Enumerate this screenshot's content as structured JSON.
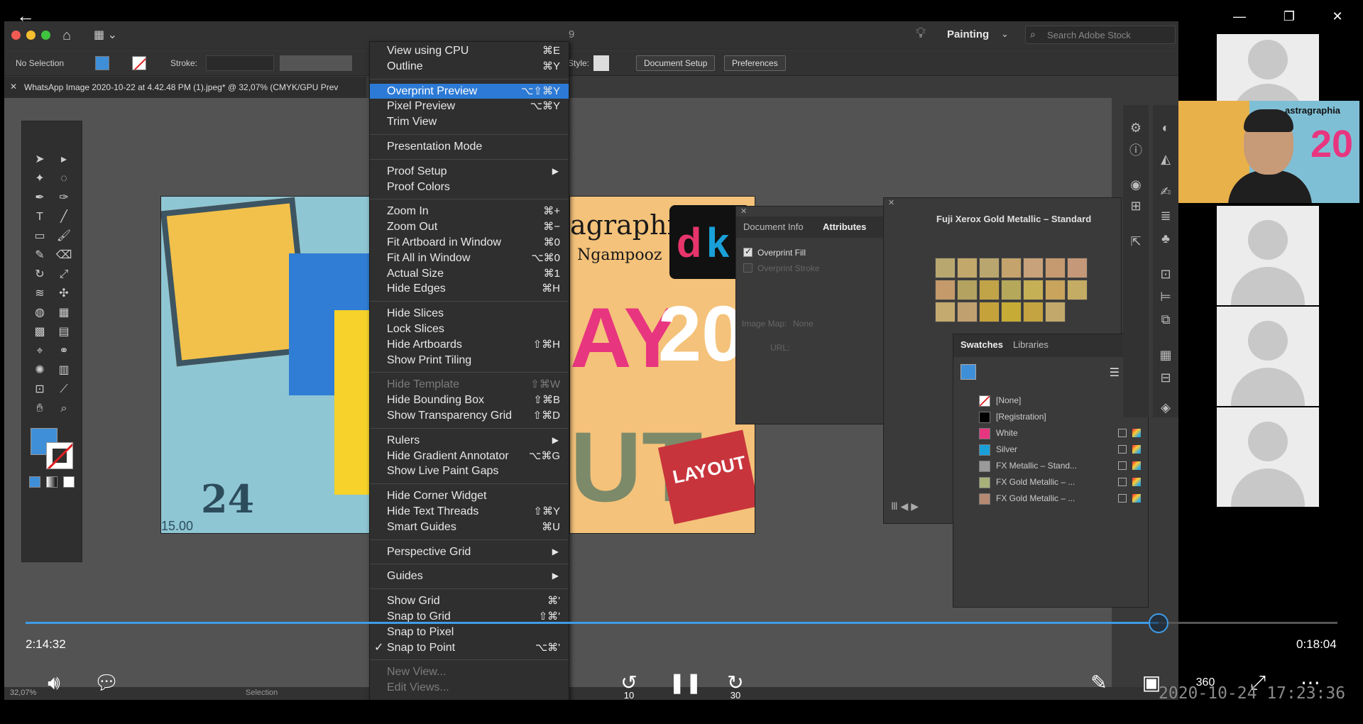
{
  "player": {
    "back_icon": "arrow-left-icon",
    "window_controls": [
      "minimize-icon",
      "restore-icon",
      "close-icon"
    ],
    "time_elapsed": "2:14:32",
    "time_remaining": "0:18:04",
    "progress_fraction": 0.8635,
    "controls": {
      "volume": "volume-icon",
      "captions": "captions-icon",
      "rewind_label": "10",
      "pause": "pause-icon",
      "forward_label": "30",
      "pen": "pen-icon",
      "miniview": "mini-view-icon",
      "three_sixty_label": "360",
      "fullscreen": "fullscreen-icon",
      "more": "more-icon"
    },
    "timestamp_overlay": "2020-10-24 17:23:36"
  },
  "illustrator": {
    "title_fragment": "9",
    "workspace": "Painting",
    "stock_search_placeholder": "Search Adobe Stock",
    "control": {
      "no_selection": "No Selection",
      "stroke_label": "Stroke:",
      "style_label": "Style:",
      "document_setup": "Document Setup",
      "preferences": "Preferences"
    },
    "doc_tab": "WhatsApp Image 2020-10-22 at 4.42.48 PM (1).jpeg* @ 32,07% (CMYK/GPU Prev",
    "status": {
      "zoom": "32,07%",
      "tool": "Selection"
    },
    "colors": {
      "fill": "#3f8fd8",
      "stroke_none": "#e02020",
      "menu_highlight": "#2c7ad6"
    }
  },
  "view_menu": [
    {
      "label": "View using CPU",
      "shortcut": "⌘E"
    },
    {
      "label": "Outline",
      "shortcut": "⌘Y"
    },
    {
      "sep": true
    },
    {
      "label": "Overprint Preview",
      "shortcut": "⌥⇧⌘Y",
      "highlight": true
    },
    {
      "label": "Pixel Preview",
      "shortcut": "⌥⌘Y"
    },
    {
      "label": "Trim View",
      "shortcut": ""
    },
    {
      "sep": true
    },
    {
      "label": "Presentation Mode",
      "shortcut": ""
    },
    {
      "sep": true
    },
    {
      "label": "Proof Setup",
      "shortcut": "",
      "submenu": true
    },
    {
      "label": "Proof Colors",
      "shortcut": ""
    },
    {
      "sep": true
    },
    {
      "label": "Zoom In",
      "shortcut": "⌘+"
    },
    {
      "label": "Zoom Out",
      "shortcut": "⌘−"
    },
    {
      "label": "Fit Artboard in Window",
      "shortcut": "⌘0"
    },
    {
      "label": "Fit All in Window",
      "shortcut": "⌥⌘0"
    },
    {
      "label": "Actual Size",
      "shortcut": "⌘1"
    },
    {
      "label": "Hide Edges",
      "shortcut": "⌘H"
    },
    {
      "sep": true
    },
    {
      "label": "Hide Slices",
      "shortcut": ""
    },
    {
      "label": "Lock Slices",
      "shortcut": ""
    },
    {
      "label": "Hide Artboards",
      "shortcut": "⇧⌘H"
    },
    {
      "label": "Show Print Tiling",
      "shortcut": ""
    },
    {
      "sep": true
    },
    {
      "label": "Hide Template",
      "shortcut": "⇧⌘W",
      "disabled": true
    },
    {
      "label": "Hide Bounding Box",
      "shortcut": "⇧⌘B"
    },
    {
      "label": "Show Transparency Grid",
      "shortcut": "⇧⌘D"
    },
    {
      "sep": true
    },
    {
      "label": "Rulers",
      "shortcut": "",
      "submenu": true
    },
    {
      "label": "Hide Gradient Annotator",
      "shortcut": "⌥⌘G"
    },
    {
      "label": "Show Live Paint Gaps",
      "shortcut": ""
    },
    {
      "sep": true
    },
    {
      "label": "Hide Corner Widget",
      "shortcut": ""
    },
    {
      "label": "Hide Text Threads",
      "shortcut": "⇧⌘Y"
    },
    {
      "label": "Smart Guides",
      "shortcut": "⌘U"
    },
    {
      "sep": true
    },
    {
      "label": "Perspective Grid",
      "shortcut": "",
      "submenu": true
    },
    {
      "sep": true
    },
    {
      "label": "Guides",
      "shortcut": "",
      "submenu": true
    },
    {
      "sep": true
    },
    {
      "label": "Show Grid",
      "shortcut": "⌘'"
    },
    {
      "label": "Snap to Grid",
      "shortcut": "⇧⌘'"
    },
    {
      "label": "Snap to Pixel",
      "shortcut": ""
    },
    {
      "label": "Snap to Point",
      "shortcut": "⌥⌘'",
      "checked": true
    },
    {
      "sep": true
    },
    {
      "label": "New View...",
      "shortcut": "",
      "disabled": true
    },
    {
      "label": "Edit Views...",
      "shortcut": "",
      "disabled": true
    }
  ],
  "attributes_panel": {
    "tabs": [
      "Document Info",
      "Attributes"
    ],
    "overprint_fill": "Overprint Fill",
    "overprint_stroke": "Overprint Stroke",
    "image_map_label": "Image Map:",
    "image_map_value": "None",
    "url_label": "URL:"
  },
  "library_panel": {
    "title": "Fuji Xerox Gold Metallic – Standard",
    "gold_colors": [
      "#b8a870",
      "#c2a86a",
      "#b9a66e",
      "#c4a36c",
      "#c7a27a",
      "#c59a70",
      "#c49878",
      "#c49a6a",
      "#b4a260",
      "#c2a448",
      "#b5a85a",
      "#c6b056",
      "#c8a45c",
      "#c4ac64",
      "#c4aa6e",
      "#c1a070",
      "#c6a23a",
      "#c6ac36",
      "#c4a440",
      "#c2a86a"
    ]
  },
  "swatches_panel": {
    "tabs": [
      "Swatches",
      "Libraries"
    ],
    "items": [
      {
        "name": "[None]",
        "color": "none"
      },
      {
        "name": "[Registration]",
        "color": "#000000"
      },
      {
        "name": "White",
        "color": "#e8357f"
      },
      {
        "name": "Silver",
        "color": "#1aa0d8"
      },
      {
        "name": "FX Metallic – Stand...",
        "color": "#9a9a9a"
      },
      {
        "name": "FX Gold Metallic – ...",
        "color": "#a8b07a"
      },
      {
        "name": "FX Gold Metallic – ...",
        "color": "#b58a72"
      }
    ]
  },
  "artwork": {
    "left_date_text": "24",
    "left_time_text": "15.00",
    "right_brand": "agraphia",
    "right_sub": "Ngampooz",
    "right_big_1": "AY",
    "right_big_2": "20",
    "right_big_3": "UT",
    "right_stamp": "LAYOUT"
  },
  "live_tile": {
    "brand": "astragraphia",
    "big": "20"
  }
}
